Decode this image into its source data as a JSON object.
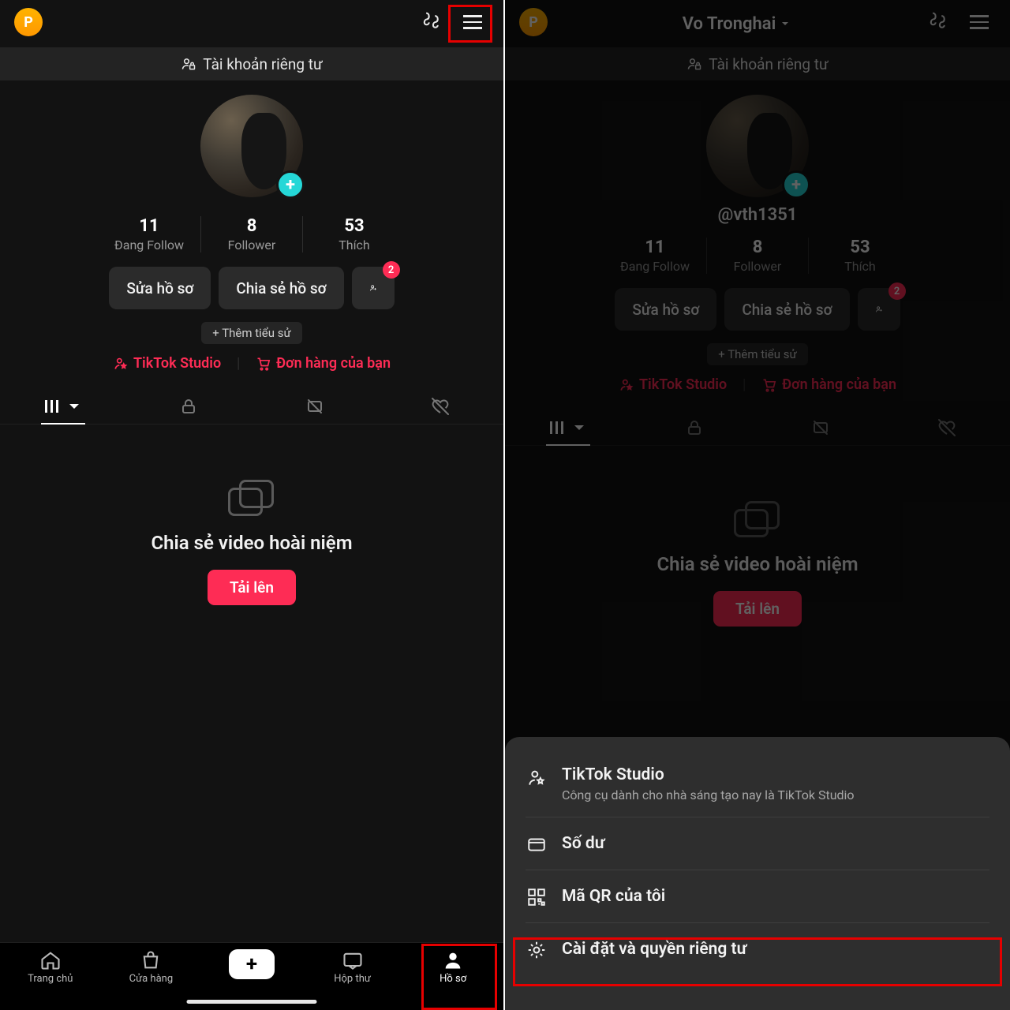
{
  "topbar": {
    "badge": "P",
    "user_name": "Vo Tronghai"
  },
  "private_banner": "Tài khoản riêng tư",
  "handle": "@vth1351",
  "stats": {
    "following": {
      "num": "11",
      "lbl": "Đang Follow"
    },
    "followers": {
      "num": "8",
      "lbl": "Follower"
    },
    "likes": {
      "num": "53",
      "lbl": "Thích"
    }
  },
  "actions": {
    "edit": "Sửa hồ sơ",
    "share": "Chia sẻ hồ sơ",
    "friend_badge": "2"
  },
  "bio_chip": "+ Thêm tiểu sử",
  "links": {
    "studio": "TikTok Studio",
    "orders": "Đơn hàng của bạn"
  },
  "empty": {
    "title": "Chia sẻ video hoài niệm",
    "upload": "Tải lên"
  },
  "nav": {
    "home": "Trang chủ",
    "shop": "Cửa hàng",
    "inbox": "Hộp thư",
    "profile": "Hồ sơ"
  },
  "sheet": {
    "studio": {
      "title": "TikTok Studio",
      "sub": "Công cụ dành cho nhà sáng tạo nay là TikTok Studio"
    },
    "balance": "Số dư",
    "qr": "Mã QR của tôi",
    "settings": "Cài đặt và quyền riêng tư"
  }
}
